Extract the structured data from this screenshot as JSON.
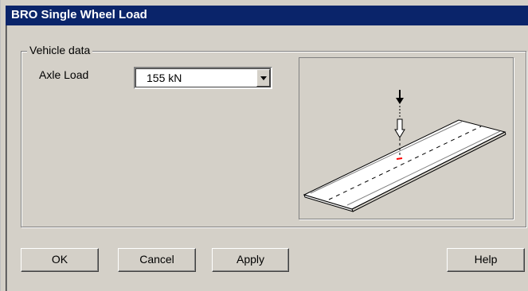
{
  "window": {
    "title": "BRO Single Wheel Load",
    "colors": {
      "titlebar": "#0a246a",
      "face": "#d4d0c8"
    }
  },
  "vehicle_data": {
    "group_label": "Vehicle data",
    "axle_load": {
      "label": "Axle Load",
      "selected_value": "155 kN"
    },
    "preview": {
      "icons": [
        "load-arrow-icon",
        "wheel-load-marker-icon",
        "road-slab-icon"
      ]
    }
  },
  "buttons": {
    "ok": "OK",
    "cancel": "Cancel",
    "apply": "Apply",
    "help": "Help"
  }
}
